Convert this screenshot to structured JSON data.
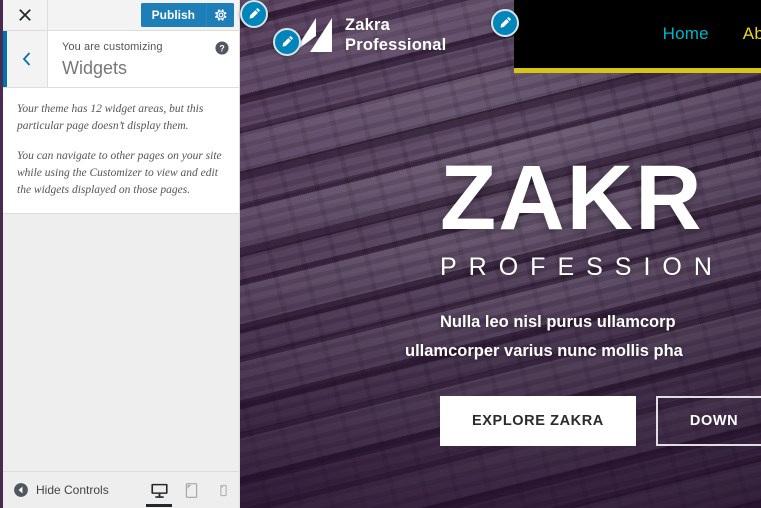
{
  "customizer": {
    "close_label": "Close",
    "close_icon": "close-icon",
    "publish_label": "Publish",
    "settings_icon": "gear-icon",
    "back_icon": "chevron-left-icon",
    "help_icon": "help-icon",
    "eyebrow": "You are customizing",
    "title": "Widgets",
    "description": [
      "Your theme has 12 widget areas, but this particular page doesn’t display them.",
      "You can navigate to other pages on your site while using the Customizer to view and edit the widgets displayed on those pages."
    ],
    "hide_controls_label": "Hide Controls",
    "hide_controls_icon": "collapse-left-icon",
    "devices": [
      {
        "name": "desktop",
        "icon": "desktop-icon",
        "active": true
      },
      {
        "name": "tablet",
        "icon": "tablet-icon",
        "active": false
      },
      {
        "name": "mobile",
        "icon": "mobile-icon",
        "active": false
      }
    ],
    "accent_color": "#0073aa",
    "publish_color": "#1d7eb8"
  },
  "preview": {
    "brand": {
      "line1": "Zakra",
      "line2": "Professional",
      "logo_icon": "zakra-z-logo"
    },
    "nav": [
      {
        "label": "Home",
        "color": "#00b5c9"
      },
      {
        "label": "Ab",
        "color": "#e8d91b"
      }
    ],
    "nav_underline_color": "#d6c516",
    "nav_background": "#000000",
    "hero": {
      "title": "ZAKR",
      "subtitle": "PROFESSION",
      "desc_line1": "Nulla leo nisl purus ullamcorp",
      "desc_line2": "ullamcorper varius nunc mollis pha",
      "button_primary": "EXPLORE ZAKRA",
      "button_secondary": "DOWN"
    },
    "edit_shortcuts": [
      {
        "name": "edit-shortcut-outer",
        "icon": "pencil-icon"
      },
      {
        "name": "edit-shortcut-logo",
        "icon": "pencil-icon"
      },
      {
        "name": "edit-shortcut-nav",
        "icon": "pencil-icon"
      }
    ]
  }
}
